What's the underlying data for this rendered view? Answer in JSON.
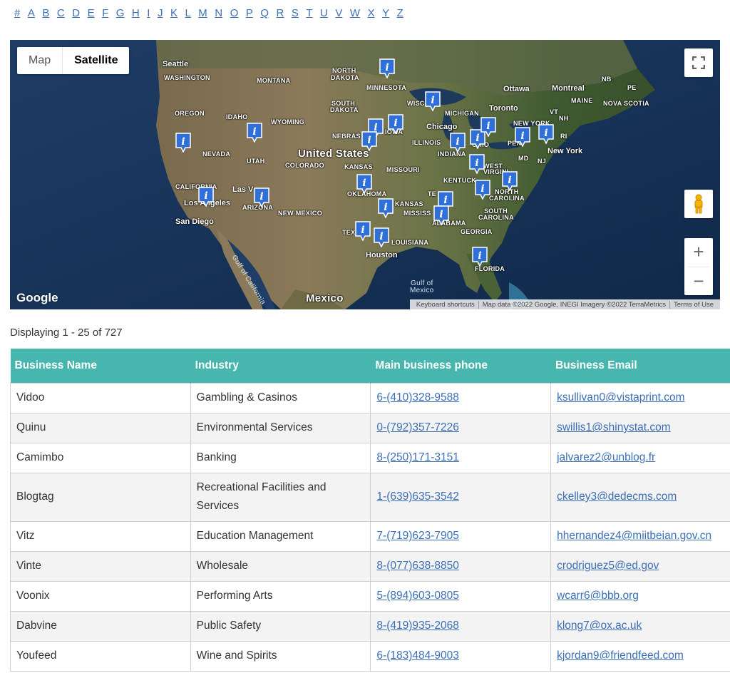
{
  "alphabet": [
    "#",
    "A",
    "B",
    "C",
    "D",
    "E",
    "F",
    "G",
    "H",
    "I",
    "J",
    "K",
    "L",
    "M",
    "N",
    "O",
    "P",
    "Q",
    "R",
    "S",
    "T",
    "U",
    "V",
    "W",
    "X",
    "Y",
    "Z"
  ],
  "map": {
    "type_options": [
      "Map",
      "Satellite"
    ],
    "selected_type": "Satellite",
    "logo": "Google",
    "attribution": [
      "Keyboard shortcuts",
      "Map data ©2022 Google, INEGI Imagery ©2022 TerraMetrics",
      "Terms of Use"
    ],
    "zoom_in": "+",
    "zoom_out": "−",
    "labels": {
      "seattle": "Seattle",
      "washington": "WASHINGTON",
      "montana": "MONTANA",
      "north_dakota_1": "NORTH",
      "north_dakota_2": "DAKOTA",
      "minnesota": "MINNESOTA",
      "ottawa": "Ottawa",
      "montreal": "Montreal",
      "nb": "NB",
      "pe": "PE",
      "maine": "MAINE",
      "nova_scotia": "NOVA SCOTIA",
      "oregon": "OREGON",
      "idaho": "IDAHO",
      "wyoming": "WYOMING",
      "south_dakota_1": "SOUTH",
      "south_dakota_2": "DAKOTA",
      "wisconsin": "WISC",
      "michigan": "MICHIGAN",
      "toronto": "Toronto",
      "new_york_state": "NEW YORK",
      "vt": "VT",
      "nh": "NH",
      "ri": "RI",
      "chicago": "Chicago",
      "nebraska": "NEBRAS",
      "iowa": "IOWA",
      "illinois": "ILLINOIS",
      "ohio": "OHIO",
      "pennsylvania": "PEN",
      "nevada": "NEVADA",
      "utah": "UTAH",
      "united_states": "United States",
      "colorado": "COLORADO",
      "indiana": "INDIANA",
      "md": "MD",
      "nj": "NJ",
      "new_york": "New York",
      "kansas": "KANSAS",
      "missouri": "MISSOURI",
      "kentucky": "KENTUCK",
      "west_virginia": "WEST",
      "virginia": "VIRGINI",
      "california": "CALIFORNIA",
      "las_vegas": "Las V",
      "oklahoma": "OKLAHOMA",
      "tennessee": "TE",
      "north_carolina_1": "NORTH",
      "north_carolina_2": "CAROLINA",
      "los_angeles": "Los Angeles",
      "arizona": "ARIZONA",
      "arkansas": "KANSAS",
      "new_mexico": "NEW MEXICO",
      "mississippi": "MISSISS",
      "south_carolina_1": "SOUTH",
      "south_carolina_2": "CAROLINA",
      "san_diego": "San Diego",
      "alabama": "ALABAMA",
      "georgia": "GEORGIA",
      "texas": "TEX",
      "louisiana": "LOUISIANA",
      "houston": "Houston",
      "florida": "FLORIDA",
      "gulf_of_california": "Gulf of California",
      "gulf_of_mexico_1": "Gulf of",
      "gulf_of_mexico_2": "Mexico",
      "mexico": "Mexico"
    },
    "pin_glyph": "i"
  },
  "listing": {
    "count_text": "Displaying 1 - 25 of 727",
    "columns": [
      "Business Name",
      "Industry",
      "Main business phone",
      "Business Email"
    ],
    "rows": [
      {
        "name": "Vidoo",
        "industry": "Gambling & Casinos",
        "phone": "6-(410)328-9588",
        "email": "ksullivan0@vistaprint.com"
      },
      {
        "name": "Quinu",
        "industry": "Environmental Services",
        "phone": "0-(792)357-7226",
        "email": "swillis1@shinystat.com"
      },
      {
        "name": "Camimbo",
        "industry": "Banking",
        "phone": "8-(250)171-3151",
        "email": "jalvarez2@unblog.fr"
      },
      {
        "name": "Blogtag",
        "industry": "Recreational Facilities and Services",
        "phone": "1-(639)635-3542",
        "email": "ckelley3@dedecms.com"
      },
      {
        "name": "Vitz",
        "industry": "Education Management",
        "phone": "7-(719)623-7905",
        "email": "hhernandez4@miitbeian.gov.cn"
      },
      {
        "name": "Vinte",
        "industry": "Wholesale",
        "phone": "8-(077)638-8850",
        "email": "crodriguez5@ed.gov"
      },
      {
        "name": "Voonix",
        "industry": "Performing Arts",
        "phone": "5-(894)603-0805",
        "email": "wcarr6@bbb.org"
      },
      {
        "name": "Dabvine",
        "industry": "Public Safety",
        "phone": "8-(419)935-2068",
        "email": "klong7@ox.ac.uk"
      },
      {
        "name": "Youfeed",
        "industry": "Wine and Spirits",
        "phone": "6-(183)484-9003",
        "email": "kjordan9@friendfeed.com"
      }
    ]
  }
}
